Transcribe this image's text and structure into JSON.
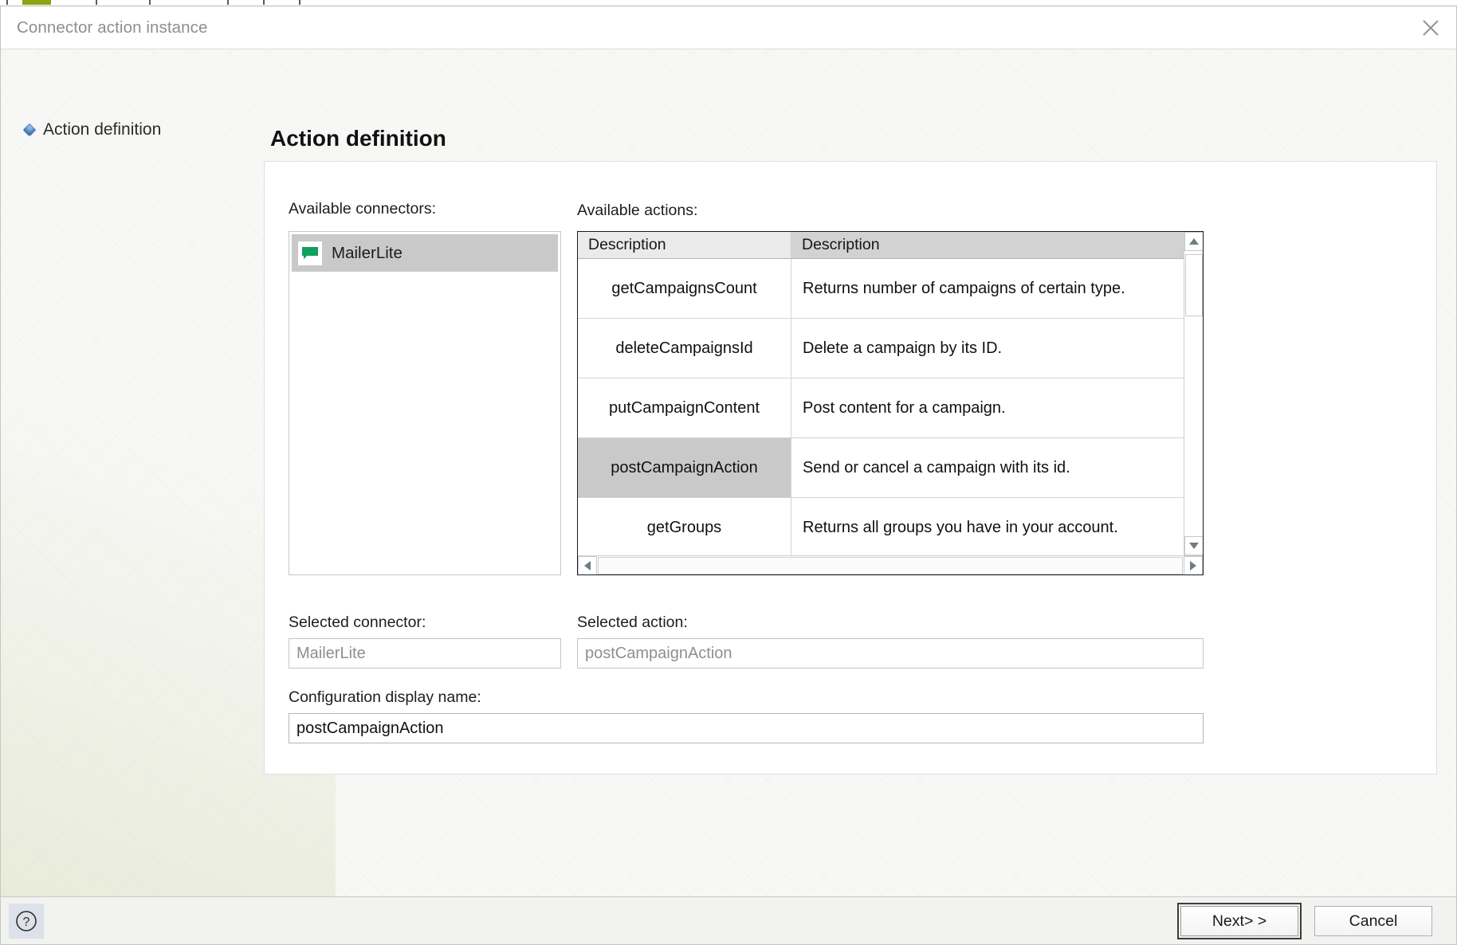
{
  "window": {
    "title": "Connector action instance",
    "close_icon": "close-icon"
  },
  "sidebar": {
    "items": [
      {
        "label": "Action definition",
        "icon": "step-bullet-icon",
        "active": true
      }
    ]
  },
  "page": {
    "title": "Action definition"
  },
  "connectors": {
    "label": "Available connectors:",
    "items": [
      {
        "name": "MailerLite",
        "icon": "mailerlite-chat-icon",
        "selected": true
      }
    ]
  },
  "actions": {
    "label": "Available actions:",
    "columns": [
      "Description",
      "Description"
    ],
    "rows": [
      {
        "name": "getCampaignsCount",
        "description": "Returns number of campaigns of certain type.",
        "selected": false
      },
      {
        "name": "deleteCampaignsId",
        "description": "Delete a campaign by its ID.",
        "selected": false
      },
      {
        "name": "putCampaignContent",
        "description": "Post content for a campaign.",
        "selected": false
      },
      {
        "name": "postCampaignAction",
        "description": "Send or cancel a campaign with its id.",
        "selected": true
      },
      {
        "name": "getGroups",
        "description": "Returns all groups you have in your account.",
        "selected": false
      }
    ],
    "scrollbar": {
      "up_icon": "scroll-up-arrow-icon",
      "down_icon": "scroll-down-arrow-icon",
      "left_icon": "scroll-left-arrow-icon",
      "right_icon": "scroll-right-arrow-icon"
    }
  },
  "fields": {
    "selected_connector": {
      "label": "Selected connector:",
      "value": "MailerLite",
      "readonly": true
    },
    "selected_action": {
      "label": "Selected action:",
      "value": "postCampaignAction",
      "readonly": true
    },
    "configuration_display_name": {
      "label": "Configuration display name:",
      "value": "postCampaignAction",
      "readonly": false
    }
  },
  "footer": {
    "help_icon": "help-question-icon",
    "next_label": "Next> >",
    "cancel_label": "Cancel"
  },
  "colors": {
    "accent_green": "#11a05e",
    "selection_gray": "#c9c9c9",
    "header_gray": "#d2d2d2",
    "title_gray": "#8e8e8e",
    "olive_tab": "#8ca414"
  }
}
